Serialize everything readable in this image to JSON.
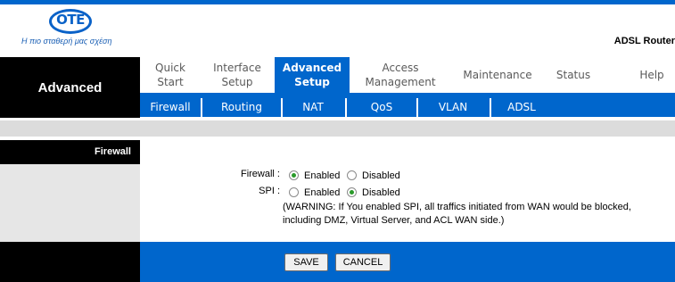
{
  "brand": {
    "logo_text": "OTE",
    "slogan": "Η πιο σταθερή μας σχέση",
    "product": "ADSL Router"
  },
  "section": "Advanced",
  "nav": [
    {
      "label": "Quick\nStart",
      "active": false
    },
    {
      "label": "Interface\nSetup",
      "active": false
    },
    {
      "label": "Advanced\nSetup",
      "active": true
    },
    {
      "label": "Access\nManagement",
      "active": false
    },
    {
      "label": "Maintenance",
      "active": false
    },
    {
      "label": "Status",
      "active": false
    },
    {
      "label": "Help",
      "active": false
    }
  ],
  "subnav": [
    "Firewall",
    "Routing",
    "NAT",
    "QoS",
    "VLAN",
    "ADSL"
  ],
  "panel": {
    "title": "Firewall",
    "firewall": {
      "label": "Firewall :",
      "selected": "Enabled",
      "options": [
        "Enabled",
        "Disabled"
      ]
    },
    "spi": {
      "label": "SPI :",
      "selected": "Disabled",
      "options": [
        "Enabled",
        "Disabled"
      ]
    },
    "warning": "(WARNING: If You enabled SPI, all traffics initiated from WAN would be blocked, including DMZ, Virtual Server, and ACL WAN side.)"
  },
  "buttons": {
    "save": "SAVE",
    "cancel": "CANCEL"
  },
  "colors": {
    "accent": "#0066cc",
    "dark": "#000000",
    "radio_selected": "#2a9a2a"
  }
}
